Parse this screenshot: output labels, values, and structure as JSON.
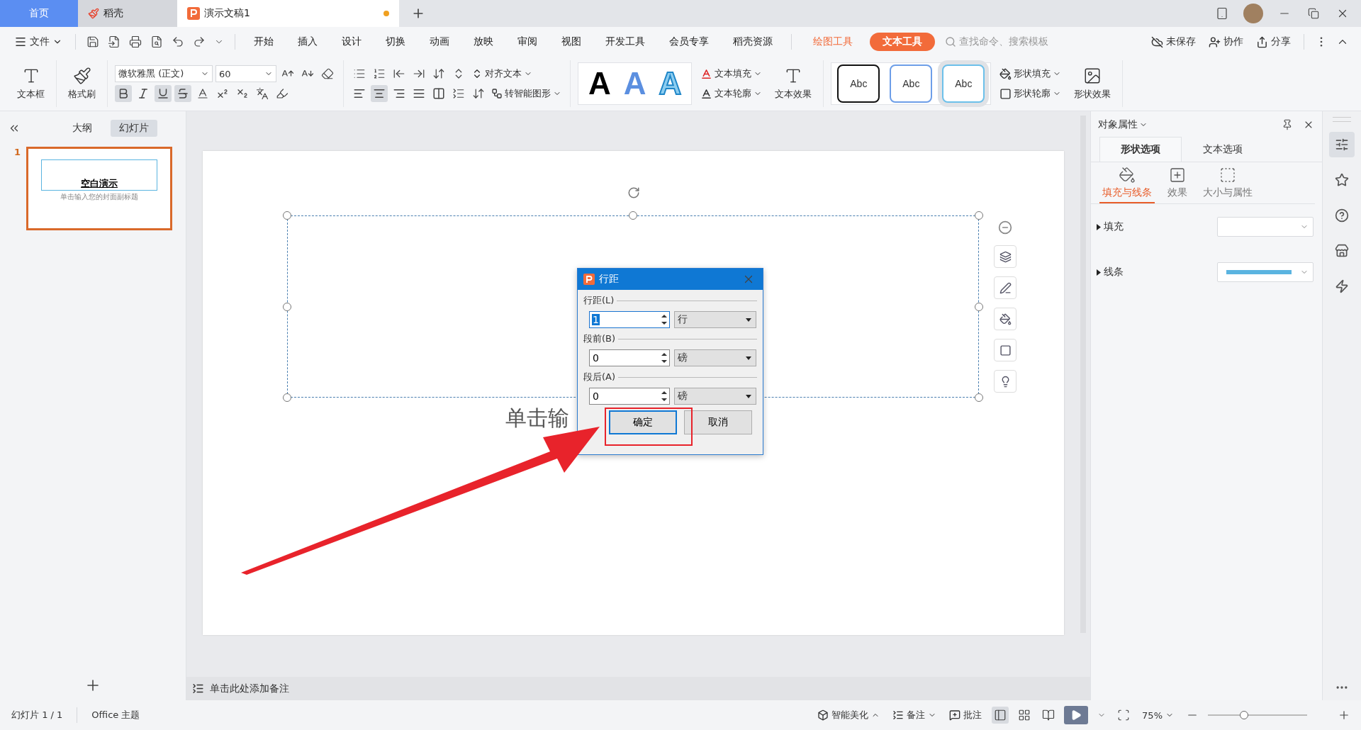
{
  "tabs": [
    {
      "label": "首页",
      "kind": "home",
      "selected": false
    },
    {
      "label": "稻壳",
      "kind": "docer",
      "selected": false
    },
    {
      "label": "演示文稿1",
      "kind": "doc",
      "selected": true,
      "unsaved": true
    }
  ],
  "menu": {
    "file": "文件",
    "items": [
      "开始",
      "插入",
      "设计",
      "切换",
      "动画",
      "放映",
      "审阅",
      "视图",
      "开发工具",
      "会员专享",
      "稻壳资源"
    ],
    "tools": [
      {
        "label": "绘图工具",
        "selected": false
      },
      {
        "label": "文本工具",
        "selected": true
      }
    ],
    "search": {
      "placeholder": "查找命令、搜索模板"
    },
    "actions": [
      "未保存",
      "协作",
      "分享"
    ]
  },
  "ribbon": {
    "textbox": "文本框",
    "format_painter": "格式刷",
    "font": "微软雅黑 (正文)",
    "size": "60",
    "format_buttons": [
      {
        "kind": "bold",
        "selected": true
      },
      {
        "kind": "italic",
        "selected": false
      },
      {
        "kind": "underline",
        "selected": true
      },
      {
        "kind": "strike",
        "selected": true
      }
    ],
    "align_buttons": [
      {
        "kind": "left",
        "selected": false
      },
      {
        "kind": "center",
        "selected": true
      },
      {
        "kind": "right",
        "selected": false
      },
      {
        "kind": "justify",
        "selected": false
      },
      {
        "kind": "distribute",
        "selected": false
      }
    ],
    "align_text": "对齐文本",
    "smart_art": "转智能图形",
    "text_styles": [
      {
        "label": "A",
        "kind": "solid"
      },
      {
        "label": "A",
        "kind": "blue"
      },
      {
        "label": "A",
        "kind": "outline"
      }
    ],
    "text_fill": "文本填充",
    "text_outline": "文本轮廓",
    "text_effect": "文本效果",
    "shape_styles": [
      {
        "label": "Abc",
        "kind": "black",
        "selected": false
      },
      {
        "label": "Abc",
        "kind": "blue",
        "selected": false
      },
      {
        "label": "Abc",
        "kind": "light",
        "selected": true
      }
    ],
    "shape_fill": "形状填充",
    "shape_outline": "形状轮廓",
    "shape_effect": "形状效果"
  },
  "left_panel": {
    "tabs": [
      {
        "label": "大纲",
        "selected": false
      },
      {
        "label": "幻灯片",
        "selected": true
      }
    ],
    "slides": [
      {
        "number": "1",
        "title": "空白演示",
        "subtitle": "单击输入您的封面副标题",
        "selected": true
      }
    ]
  },
  "slide": {
    "placeholder": "单击输"
  },
  "dialog": {
    "title": "行距",
    "sections": [
      {
        "label": "行距(L)",
        "value": "1",
        "unit": "行",
        "focused": true
      },
      {
        "label": "段前(B)",
        "value": "0",
        "unit": "磅",
        "focused": false
      },
      {
        "label": "段后(A)",
        "value": "0",
        "unit": "磅",
        "focused": false
      }
    ],
    "buttons": [
      {
        "label": "确定",
        "default": true
      },
      {
        "label": "取消",
        "default": false
      }
    ]
  },
  "right_panel": {
    "title": "对象属性",
    "tabs": [
      {
        "label": "形状选项",
        "selected": true
      },
      {
        "label": "文本选项",
        "selected": false
      }
    ],
    "subtabs": [
      {
        "label": "填充与线条",
        "kind": "fill",
        "selected": true
      },
      {
        "label": "效果",
        "kind": "effect",
        "selected": false
      },
      {
        "label": "大小与属性",
        "kind": "size",
        "selected": false
      }
    ],
    "rows": [
      {
        "label": "填充",
        "kind": "fill"
      },
      {
        "label": "线条",
        "kind": "line",
        "color": "#5ab4e0"
      }
    ]
  },
  "notes": {
    "placeholder": "单击此处添加备注"
  },
  "status_bar": {
    "slide": "幻灯片 1 / 1",
    "theme": "Office 主题",
    "beautify": "智能美化",
    "notes": "备注",
    "comments": "批注",
    "zoom": "75%",
    "level": 0.35
  }
}
